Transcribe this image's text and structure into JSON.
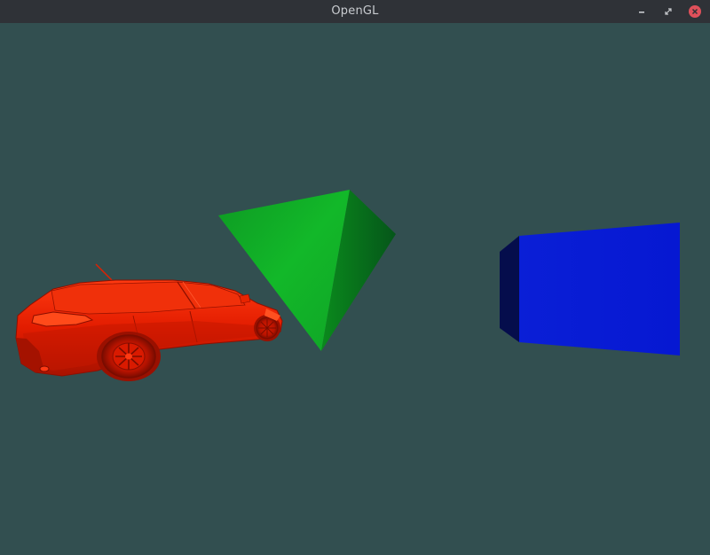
{
  "window": {
    "title": "OpenGL",
    "controls": {
      "minimize_icon": "minimize-icon",
      "restore_icon": "restore-icon",
      "close_icon": "close-icon"
    }
  },
  "scene": {
    "clear_color": "#324f50",
    "objects": [
      {
        "name": "car",
        "color": "#ff2200"
      },
      {
        "name": "pyramid",
        "color": "#13c22b"
      },
      {
        "name": "cube",
        "color": "#0818d8"
      }
    ]
  },
  "colors": {
    "titlebar_bg": "#2f3237",
    "titlebar_text": "#c9ccd0",
    "close_button": "#e0505a"
  }
}
